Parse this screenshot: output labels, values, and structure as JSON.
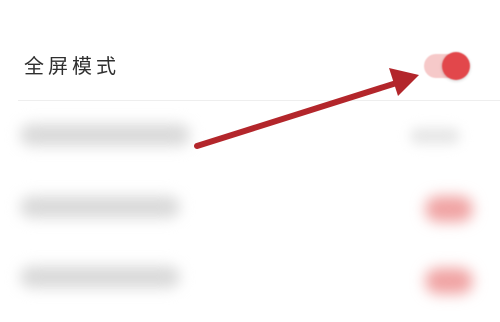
{
  "settings": {
    "fullscreen": {
      "label": "全屏模式",
      "enabled": true
    }
  },
  "colors": {
    "accent": "#e2474b",
    "toggle_track": "#f6c9c9",
    "arrow": "#b3262b"
  },
  "icons": {
    "toggle": "toggle-on-icon",
    "annotation": "arrow-pointer-icon"
  }
}
